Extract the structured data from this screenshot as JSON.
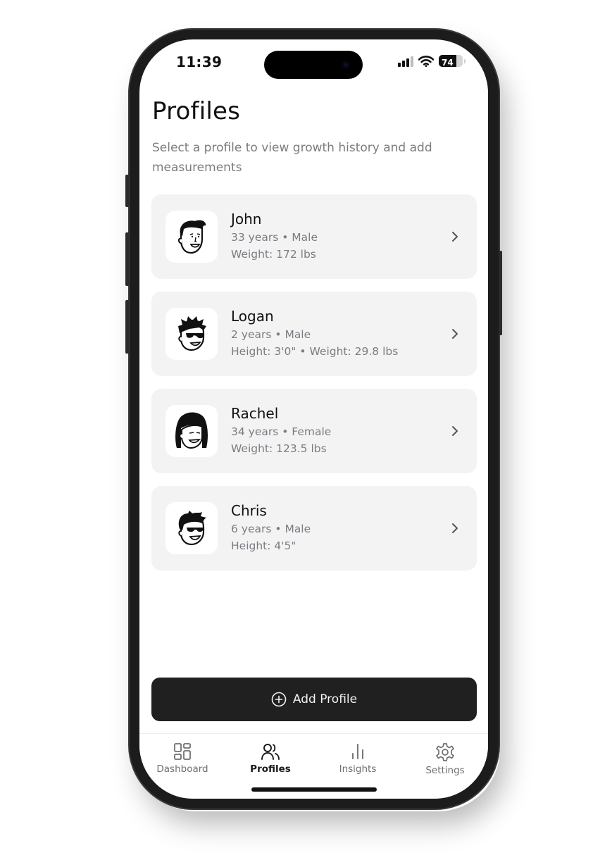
{
  "status_bar": {
    "time": "11:39",
    "battery_level": "74",
    "battery_fraction": 0.74,
    "icons": [
      "cellular-signal-icon",
      "wifi-icon",
      "battery-icon"
    ]
  },
  "header": {
    "title": "Profiles",
    "subtitle": "Select a profile to view growth history and add measurements"
  },
  "profiles": [
    {
      "name": "John",
      "meta": "33 years • Male",
      "details": "Weight: 172 lbs",
      "avatar": "man-avatar-icon"
    },
    {
      "name": "Logan",
      "meta": "2 years • Male",
      "details": "Height: 3'0\" • Weight: 29.8 lbs",
      "avatar": "boy-sunglasses-avatar-icon"
    },
    {
      "name": "Rachel",
      "meta": "34 years • Female",
      "details": "Weight: 123.5 lbs",
      "avatar": "woman-avatar-icon"
    },
    {
      "name": "Chris",
      "meta": "6 years • Male",
      "details": "Height: 4'5\"",
      "avatar": "kid-sunglasses-avatar-icon"
    }
  ],
  "add_button": {
    "label": "Add Profile",
    "icon": "plus-circle-icon"
  },
  "tabbar": {
    "active": "Profiles",
    "tabs": [
      {
        "label": "Dashboard",
        "icon": "dashboard-grid-icon"
      },
      {
        "label": "Profiles",
        "icon": "users-icon"
      },
      {
        "label": "Insights",
        "icon": "bar-chart-icon"
      },
      {
        "label": "Settings",
        "icon": "gear-icon"
      }
    ]
  }
}
